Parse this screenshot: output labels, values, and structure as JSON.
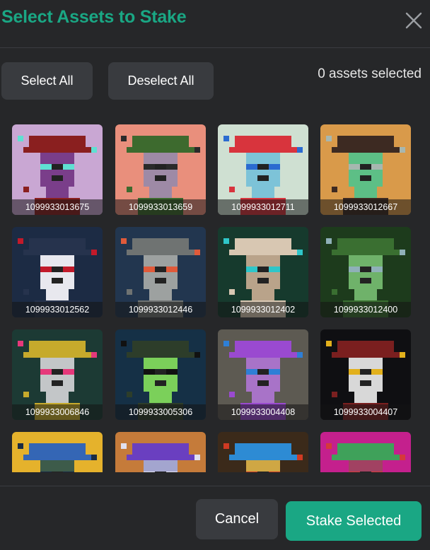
{
  "modal": {
    "title": "Select Assets to Stake",
    "close_icon": "close-icon"
  },
  "toolbar": {
    "select_all_label": "Select All",
    "deselect_all_label": "Deselect All",
    "selection_count": "0 assets selected"
  },
  "assets": [
    {
      "id": "1099933013675",
      "palette": {
        "bg": "#c9a7d3",
        "face": "#7a3e8a",
        "hat": "#8a1f1f",
        "accent": "#5fe0d2"
      }
    },
    {
      "id": "1099933013659",
      "palette": {
        "bg": "#e98f7c",
        "face": "#9e8aa6",
        "hat": "#3d6a2e",
        "accent": "#2a2a2a"
      }
    },
    {
      "id": "1099933012711",
      "palette": {
        "bg": "#cfe0d2",
        "face": "#7dc3d8",
        "hat": "#d8343d",
        "accent": "#2b6bd0"
      }
    },
    {
      "id": "1099933012667",
      "palette": {
        "bg": "#d99a4a",
        "face": "#5dbf86",
        "hat": "#3d2a22",
        "accent": "#a7b7b0"
      }
    },
    {
      "id": "1099933012562",
      "palette": {
        "bg": "#1c2b44",
        "face": "#e8e8ee",
        "hat": "#26334d",
        "accent": "#c21a2a"
      }
    },
    {
      "id": "1099933012446",
      "palette": {
        "bg": "#22364f",
        "face": "#9da1a0",
        "hat": "#6f7372",
        "accent": "#e05a3a"
      }
    },
    {
      "id": "1099933012402",
      "palette": {
        "bg": "#163a2d",
        "face": "#b9a38a",
        "hat": "#d8c7b2",
        "accent": "#2fc6c9"
      }
    },
    {
      "id": "1099933012400",
      "palette": {
        "bg": "#1d3b1c",
        "face": "#6fb26a",
        "hat": "#3a6f31",
        "accent": "#8fb0b8"
      }
    },
    {
      "id": "1099933006846",
      "palette": {
        "bg": "#1c3a34",
        "face": "#c3c6c8",
        "hat": "#c6aa2c",
        "accent": "#e6387a"
      }
    },
    {
      "id": "1099933005306",
      "palette": {
        "bg": "#153046",
        "face": "#7bd05a",
        "hat": "#2d3d2a",
        "accent": "#111111"
      }
    },
    {
      "id": "1099933004408",
      "palette": {
        "bg": "#5d5a52",
        "face": "#a873c8",
        "hat": "#9a4ad0",
        "accent": "#2e7fd6"
      }
    },
    {
      "id": "1099933004407",
      "palette": {
        "bg": "#0f0f12",
        "face": "#d8d8d8",
        "hat": "#7a1f1f",
        "accent": "#e2b01c"
      }
    },
    {
      "id": "",
      "palette": {
        "bg": "#e5b22c",
        "face": "#3d5b4a",
        "hat": "#3466b5",
        "accent": "#1a2b44"
      }
    },
    {
      "id": "",
      "palette": {
        "bg": "#c57b3a",
        "face": "#a3a5cf",
        "hat": "#6a3fc0",
        "accent": "#e1e1f0"
      }
    },
    {
      "id": "",
      "palette": {
        "bg": "#3b2a1a",
        "face": "#cfa744",
        "hat": "#2d8bd4",
        "accent": "#cf3a23"
      }
    },
    {
      "id": "",
      "palette": {
        "bg": "#c4208d",
        "face": "#a14262",
        "hat": "#3fa15a",
        "accent": "#d43a3a"
      }
    }
  ],
  "footer": {
    "cancel_label": "Cancel",
    "stake_label": "Stake Selected"
  }
}
